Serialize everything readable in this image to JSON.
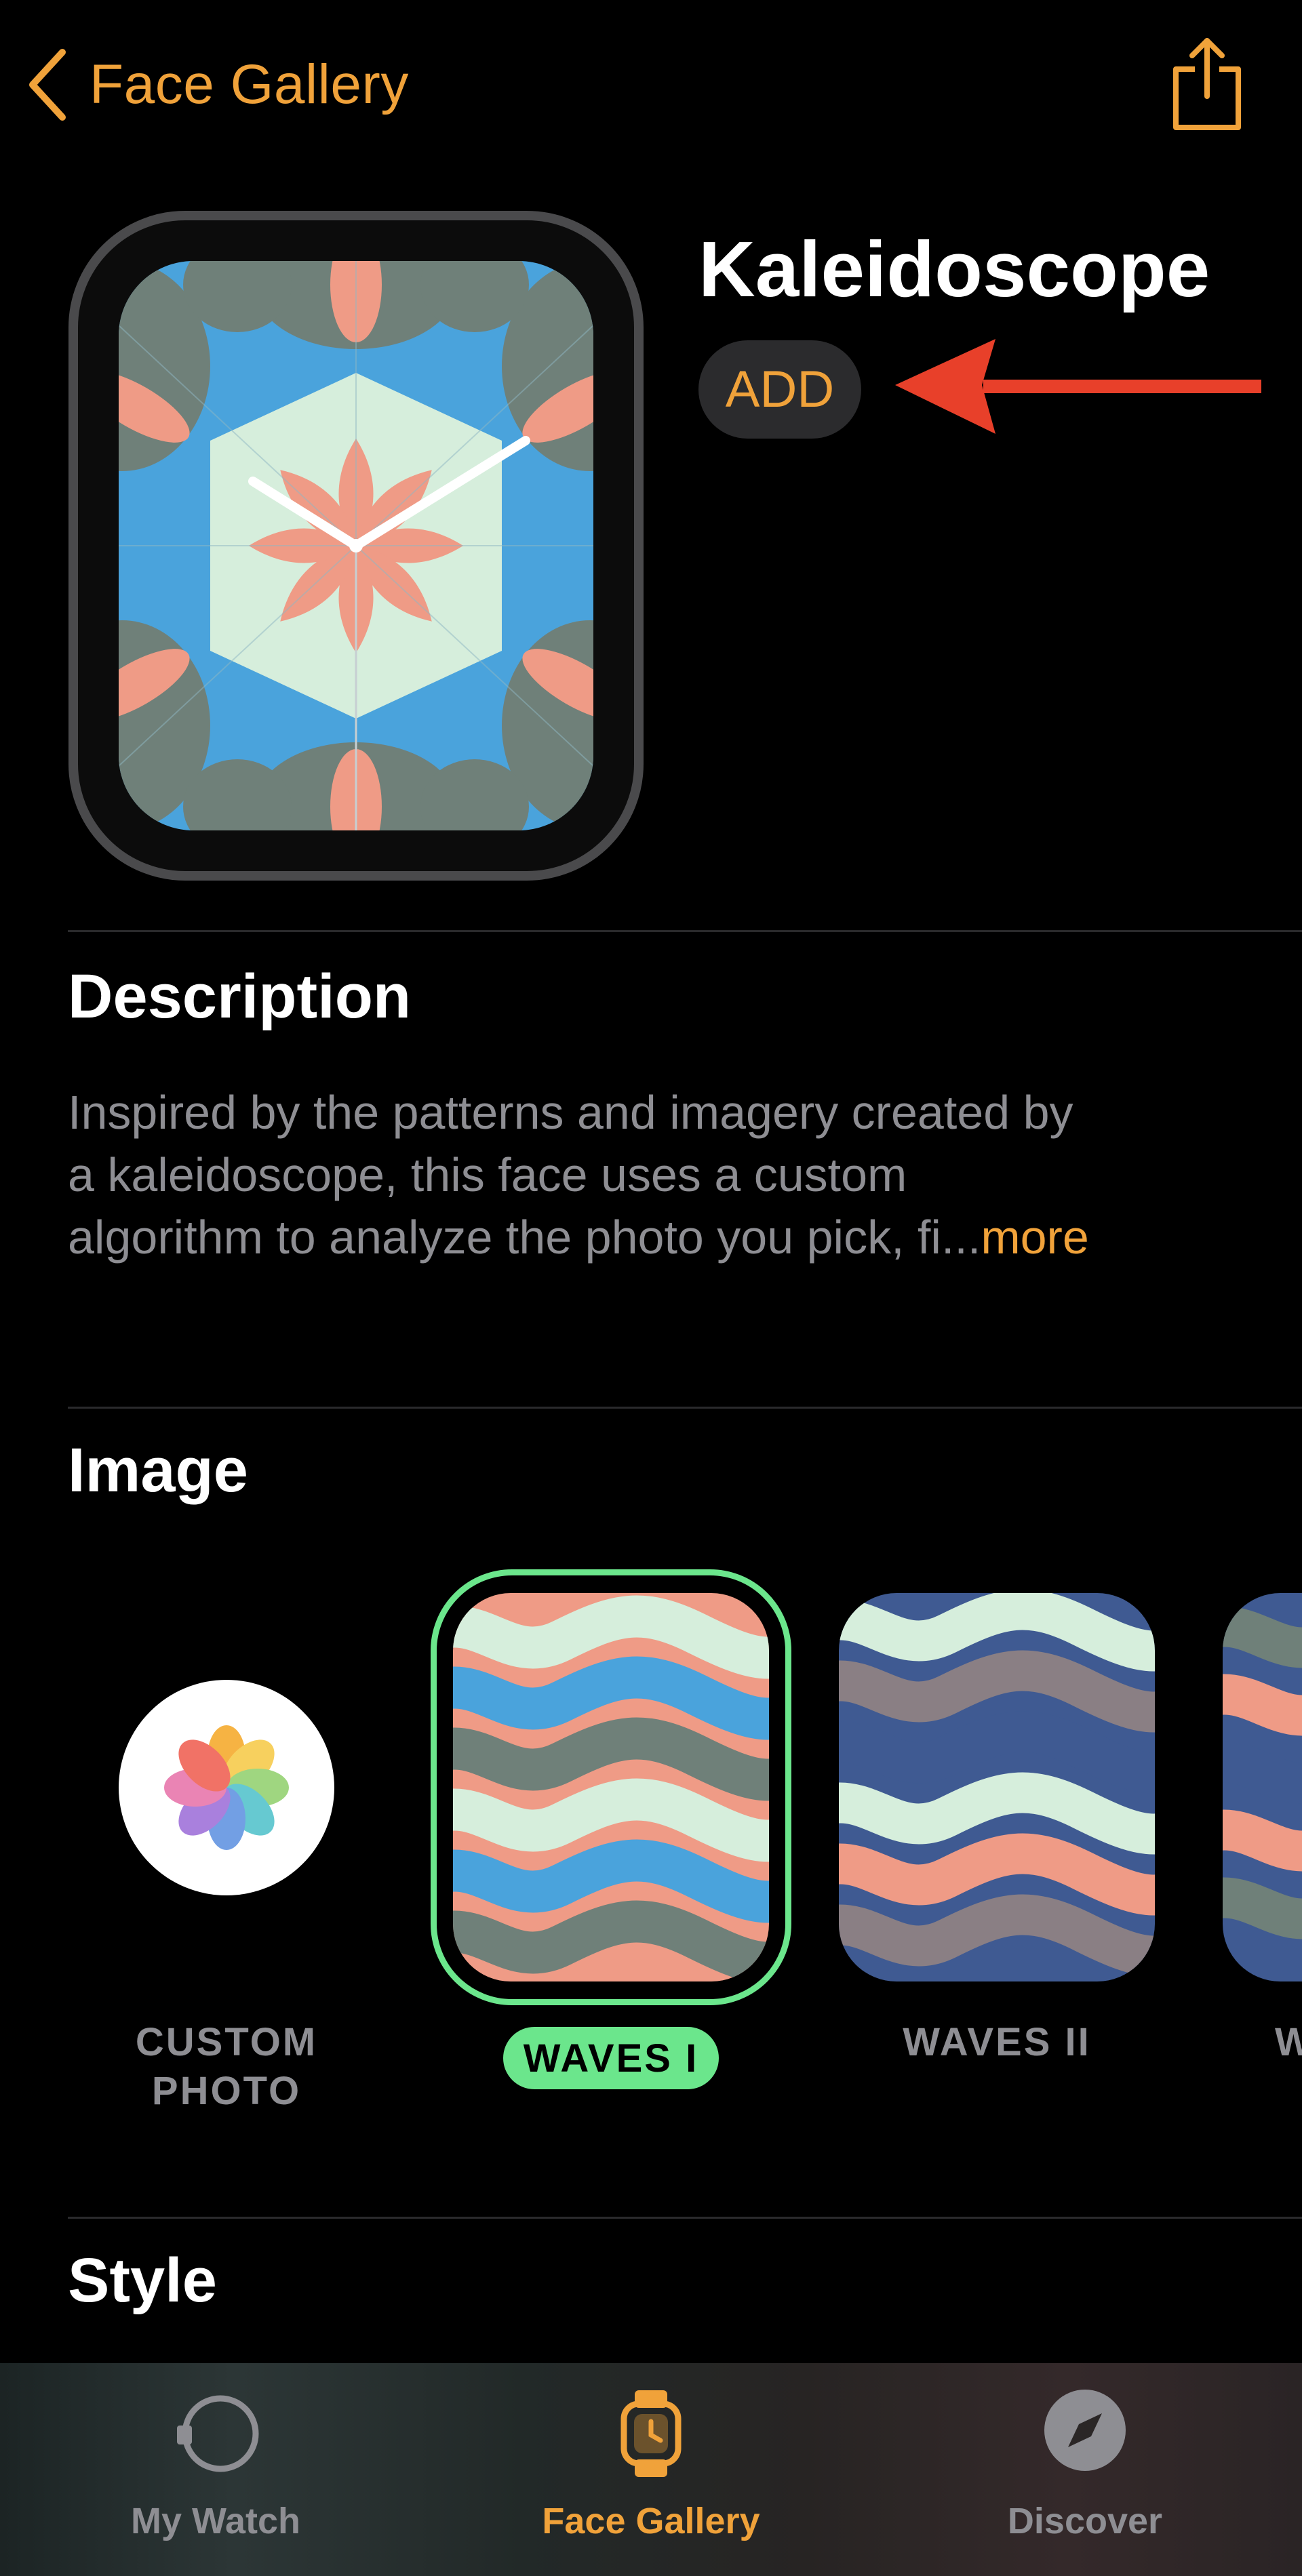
{
  "nav": {
    "back_label": "Face Gallery",
    "back_icon": "chevron-left-icon",
    "share_icon": "share-icon"
  },
  "face": {
    "title": "Kaleidoscope",
    "add_label": "ADD"
  },
  "description": {
    "heading": "Description",
    "lines": [
      "Inspired by the patterns and imagery created by",
      "a kaleidoscope, this face uses a custom",
      "algorithm to analyze the photo you pick, fi..."
    ],
    "more_label": "more"
  },
  "image_section": {
    "heading": "Image",
    "options": [
      {
        "label_line1": "CUSTOM",
        "label_line2": "PHOTO",
        "icon": "photos-app-icon",
        "selected": false
      },
      {
        "label": "WAVES I",
        "selected": true
      },
      {
        "label": "WAVES II",
        "selected": false
      },
      {
        "label": "W",
        "selected": false
      }
    ]
  },
  "style_section": {
    "heading": "Style"
  },
  "tab_bar": {
    "tabs": [
      {
        "label": "My Watch",
        "icon": "watch-outline-icon",
        "active": false
      },
      {
        "label": "Face Gallery",
        "icon": "watch-face-icon",
        "active": true
      },
      {
        "label": "Discover",
        "icon": "compass-icon",
        "active": false
      }
    ]
  },
  "colors": {
    "accent": "#f0a23a",
    "selected_green": "#6be68c",
    "secondary_text": "#8e8e93",
    "annotation_arrow": "#e8402a",
    "background": "#000000"
  }
}
